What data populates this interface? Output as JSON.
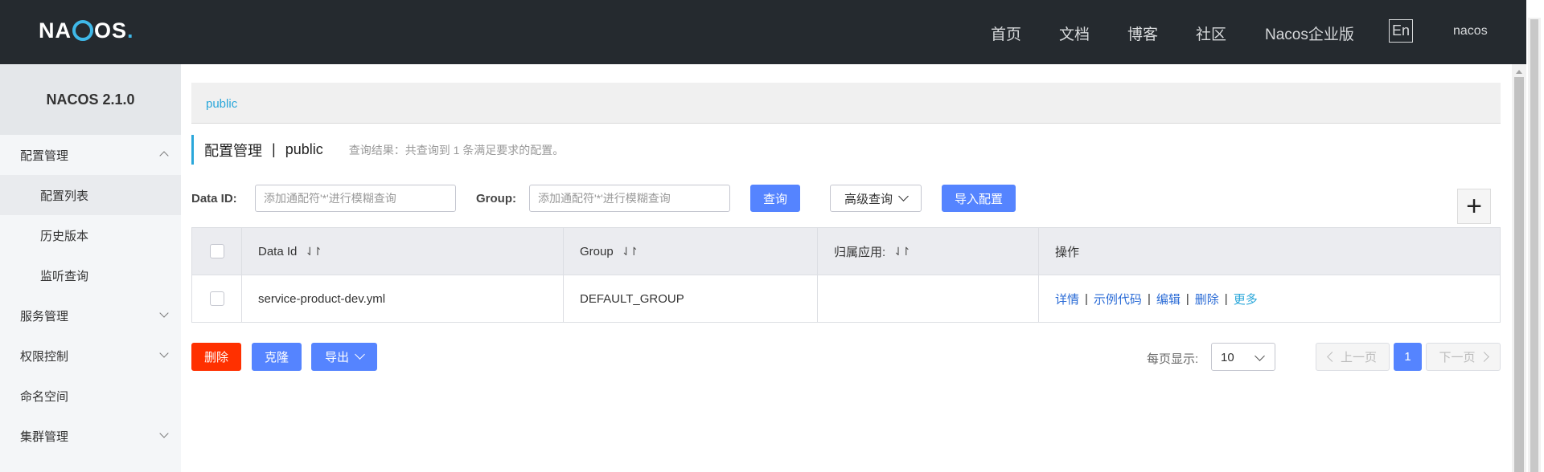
{
  "header": {
    "logo": "NACOS",
    "nav": [
      "首页",
      "文档",
      "博客",
      "社区",
      "Nacos企业版"
    ],
    "lang_button": "En",
    "user": "nacos"
  },
  "sidebar": {
    "version": "NACOS 2.1.0",
    "items": [
      {
        "label": "配置管理",
        "expanded": true
      },
      {
        "label": "配置列表",
        "active": true
      },
      {
        "label": "历史版本"
      },
      {
        "label": "监听查询"
      },
      {
        "label": "服务管理"
      },
      {
        "label": "权限控制"
      },
      {
        "label": "命名空间"
      },
      {
        "label": "集群管理"
      }
    ]
  },
  "breadcrumb": {
    "namespace": "public"
  },
  "page": {
    "title": "配置管理",
    "separator": "|",
    "namespace": "public",
    "hint": "查询结果：共查询到 1 条满足要求的配置。"
  },
  "search": {
    "data_id_label": "Data ID:",
    "data_id_placeholder": "添加通配符'*'进行模糊查询",
    "group_label": "Group:",
    "group_placeholder": "添加通配符'*'进行模糊查询",
    "query_button": "查询",
    "advanced_button": "高级查询",
    "import_button": "导入配置",
    "add_button": "+"
  },
  "table": {
    "columns": [
      "Data Id",
      "Group",
      "归属应用:",
      "操作"
    ],
    "sort_icon": "⇃↾",
    "rows": [
      {
        "data_id": "service-product-dev.yml",
        "group": "DEFAULT_GROUP",
        "app": "",
        "ops": [
          "详情",
          "示例代码",
          "编辑",
          "删除",
          "更多"
        ],
        "op_separator": "|"
      }
    ]
  },
  "footer": {
    "delete_button": "删除",
    "clone_button": "克隆",
    "export_button": "导出",
    "page_size_label": "每页显示:",
    "page_size": "10",
    "prev_button": "上一页",
    "current_page": "1",
    "next_button": "下一页"
  },
  "colors": {
    "topbar": "#252a2f",
    "accent": "#2aa7da",
    "primary": "#5584ff",
    "danger": "#ff3000"
  }
}
